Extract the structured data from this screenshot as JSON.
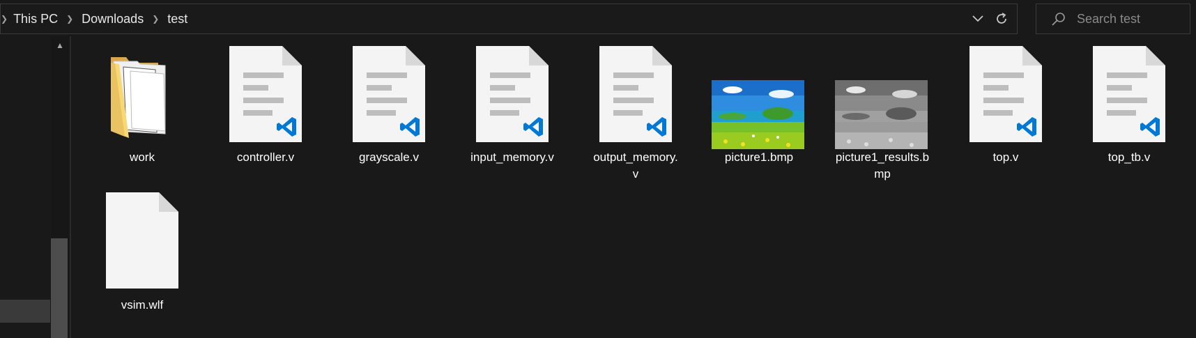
{
  "address_bar": {
    "breadcrumbs": [
      "This PC",
      "Downloads",
      "test"
    ],
    "dropdown_icon": "chevron-down-icon",
    "refresh_icon": "refresh-icon"
  },
  "search": {
    "placeholder": "Search test",
    "icon": "search-icon"
  },
  "files": [
    {
      "name": "work",
      "type": "folder"
    },
    {
      "name": "controller.v",
      "type": "vscode-doc"
    },
    {
      "name": "grayscale.v",
      "type": "vscode-doc"
    },
    {
      "name": "input_memory.v",
      "type": "vscode-doc"
    },
    {
      "name": "output_memory.\nv",
      "type": "vscode-doc"
    },
    {
      "name": "picture1.bmp",
      "type": "image-color"
    },
    {
      "name": "picture1_results.b\nmp",
      "type": "image-gray"
    },
    {
      "name": "top.v",
      "type": "vscode-doc"
    },
    {
      "name": "top_tb.v",
      "type": "vscode-doc"
    },
    {
      "name": "vsim.wlf",
      "type": "blank-doc"
    }
  ],
  "colors": {
    "background": "#191919",
    "vscode_blue": "#0078d4",
    "folder_yellow": "#f8d775"
  }
}
